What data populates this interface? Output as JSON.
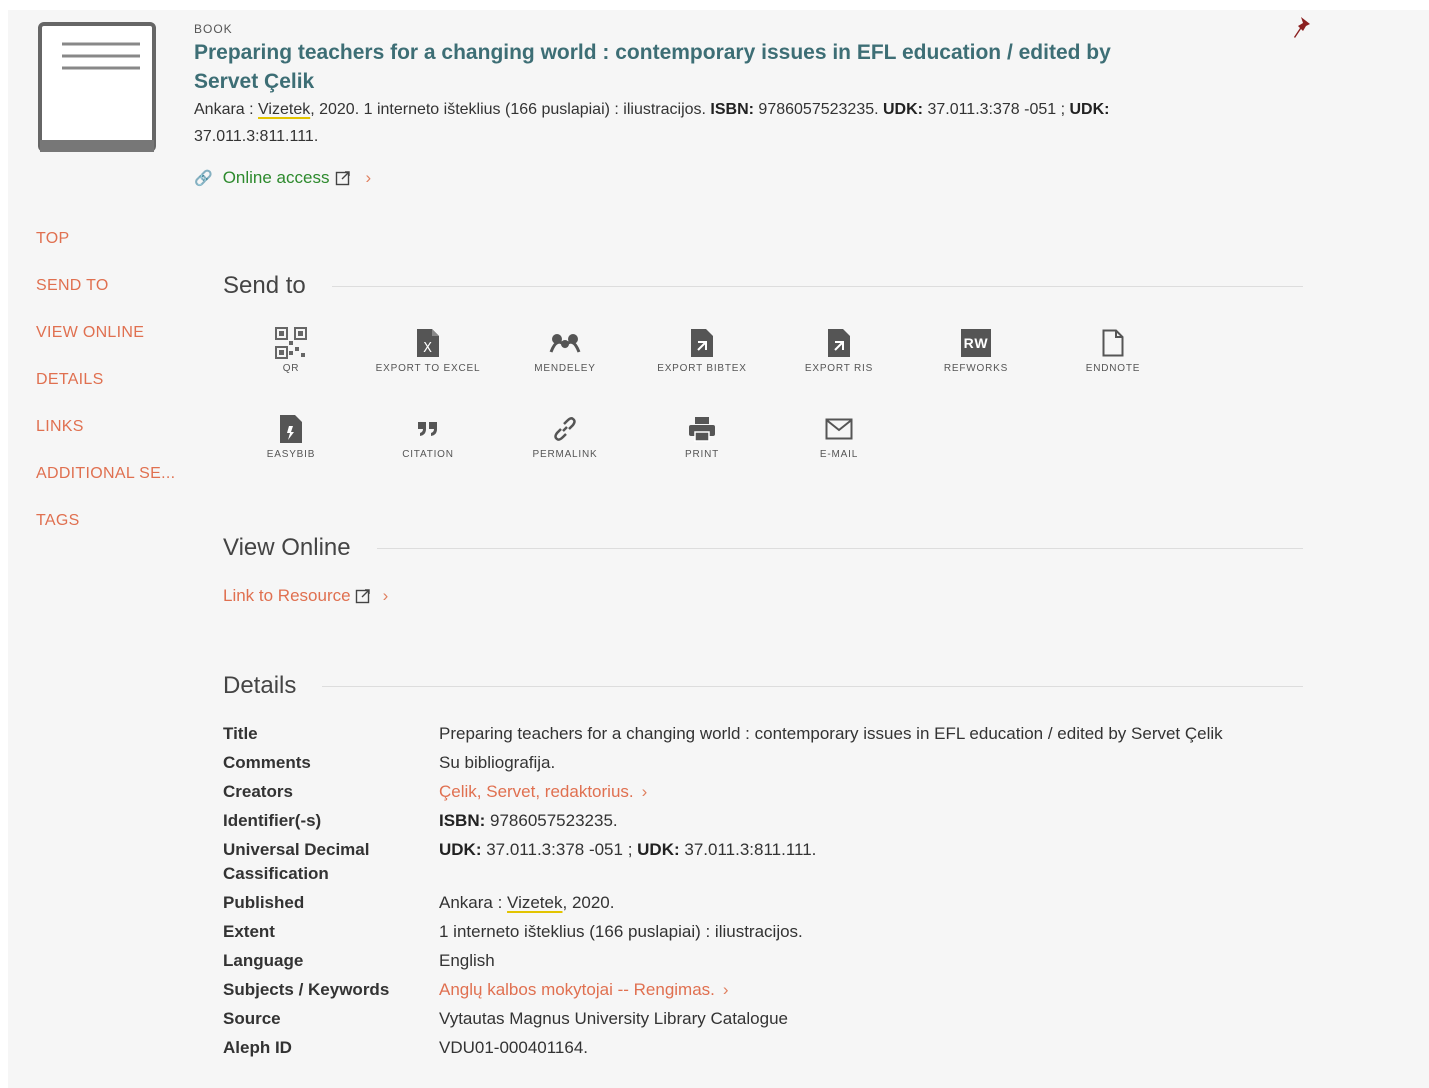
{
  "record": {
    "type_label": "BOOK",
    "title_line1": "Preparing teachers for a changing world : contemporary issues in EFL education / edited by",
    "title_line2": "Servet Çelik",
    "meta_prefix": "Ankara : ",
    "meta_publisher": "Vizetek",
    "meta_after_publisher": ", 2020. 1 interneto išteklius (166 puslapiai) : iliustracijos. ",
    "isbn_label": "ISBN:",
    "isbn_value": " 9786057523235. ",
    "udk_label1": "UDK:",
    "udk_value1": " 37.011.3:378 -051 ; ",
    "udk_label2": "UDK:",
    "udk_value2": " 37.011.3:811.111.",
    "online_access": "Online access"
  },
  "nav": {
    "items": [
      "TOP",
      "SEND TO",
      "VIEW ONLINE",
      "DETAILS",
      "LINKS",
      "ADDITIONAL SE...",
      "TAGS"
    ]
  },
  "send_to": {
    "heading": "Send to",
    "actions": [
      {
        "label": "QR",
        "icon": "qr-code-icon"
      },
      {
        "label": "EXPORT TO EXCEL",
        "icon": "excel-file-icon"
      },
      {
        "label": "MENDELEY",
        "icon": "mendeley-icon"
      },
      {
        "label": "EXPORT BIBTEX",
        "icon": "bibtex-file-icon"
      },
      {
        "label": "EXPORT RIS",
        "icon": "ris-file-icon"
      },
      {
        "label": "REFWORKS",
        "icon": "refworks-icon",
        "badge": "RW"
      },
      {
        "label": "ENDNOTE",
        "icon": "endnote-file-icon"
      },
      {
        "label": "EASYBIB",
        "icon": "easybib-file-icon"
      },
      {
        "label": "CITATION",
        "icon": "quote-icon"
      },
      {
        "label": "PERMALINK",
        "icon": "link-icon"
      },
      {
        "label": "PRINT",
        "icon": "printer-icon"
      },
      {
        "label": "E-MAIL",
        "icon": "envelope-icon"
      }
    ]
  },
  "view_online": {
    "heading": "View Online",
    "link_label": "Link to Resource"
  },
  "details": {
    "heading": "Details",
    "title_k": "Title",
    "title_v": "Preparing teachers for a changing world : contemporary issues in EFL education / edited by Servet Çelik",
    "comments_k": "Comments",
    "comments_v": "Su bibliografija.",
    "creators_k": "Creators",
    "creators_v": "Çelik, Servet, redaktorius.",
    "identifier_k": "Identifier(-s)",
    "identifier_label": "ISBN:",
    "identifier_v": " 9786057523235.",
    "udc_k": "Universal Decimal Cassification",
    "udc_label1": "UDK:",
    "udc_v1": " 37.011.3:378 -051 ; ",
    "udc_label2": "UDK:",
    "udc_v2": " 37.011.3:811.111.",
    "published_k": "Published",
    "published_prefix": "Ankara : ",
    "published_publisher": "Vizetek",
    "published_suffix": ", 2020.",
    "extent_k": "Extent",
    "extent_v": "1 interneto išteklius (166 puslapiai) : iliustracijos.",
    "language_k": "Language",
    "language_v": "English",
    "subjects_k": "Subjects / Keywords",
    "subjects_v": "Anglų kalbos mokytojai -- Rengimas.",
    "source_k": "Source",
    "source_v": "Vytautas Magnus University Library Catalogue",
    "aleph_k": "Aleph ID",
    "aleph_v": "VDU01-000401164."
  },
  "colors": {
    "title": "#3d6e75",
    "link": "#e07050",
    "online": "#2d8a2d",
    "pin": "#8b2020"
  }
}
